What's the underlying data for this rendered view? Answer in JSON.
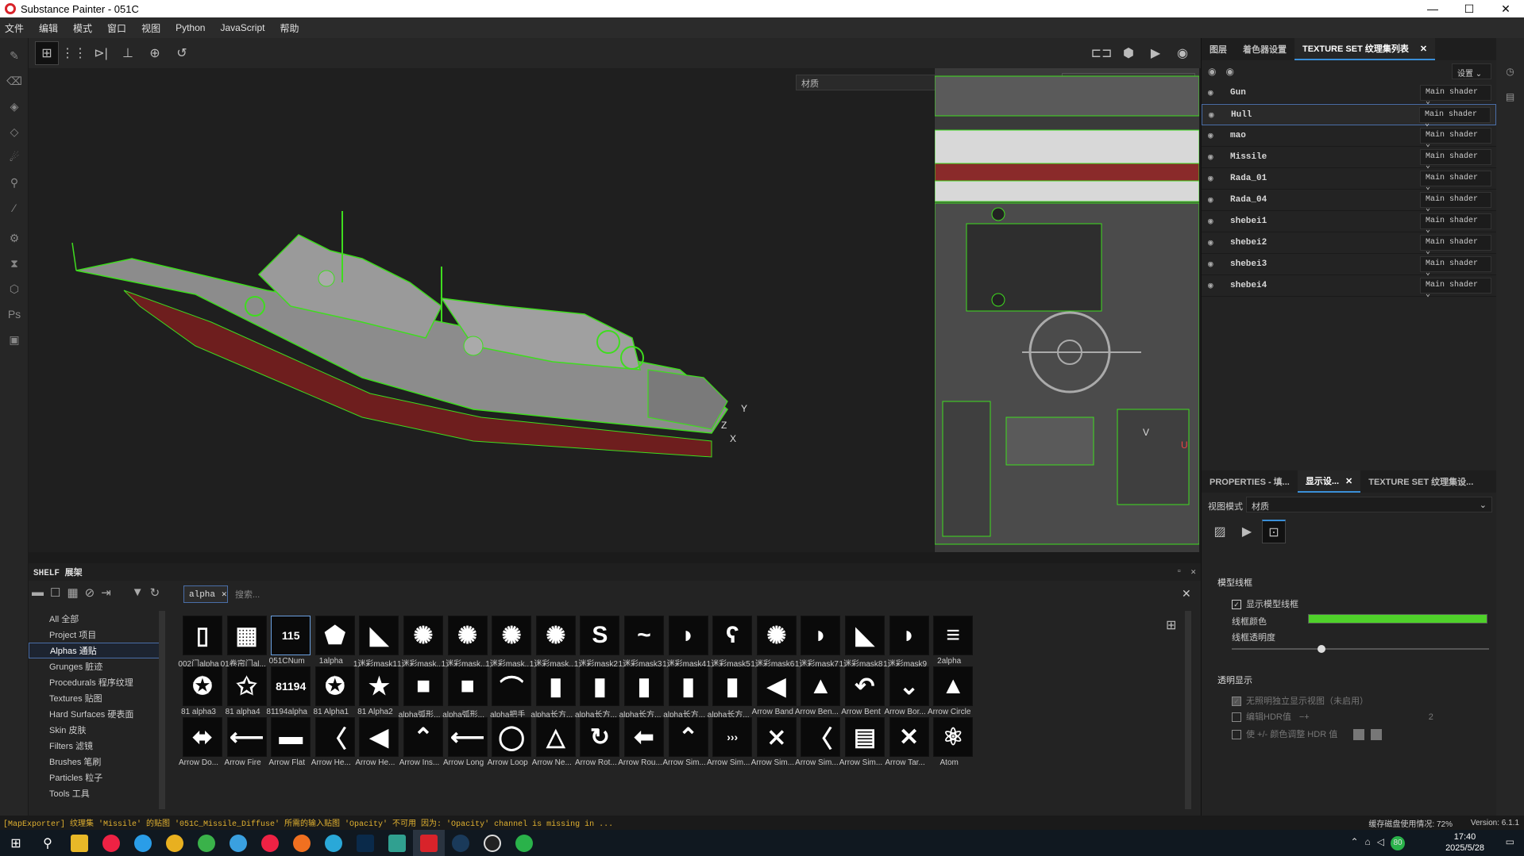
{
  "window": {
    "title": "Substance Painter - 051C"
  },
  "menu": [
    "文件",
    "编辑",
    "模式",
    "窗口",
    "视图",
    "Python",
    "JavaScript",
    "帮助"
  ],
  "viewport": {
    "material_select": "材质",
    "material_select2": "材质",
    "axis_y": "Y",
    "axis_z": "Z",
    "axis_x": "X",
    "uv_v": "V",
    "uv_u": "U"
  },
  "right_tabs": {
    "layers": "图层",
    "shader": "着色器设置",
    "texture_set_list": "TEXTURE SET 纹理集列表"
  },
  "settings_label": "设置",
  "texture_sets": [
    {
      "name": "Gun",
      "shader": "Main shader"
    },
    {
      "name": "Hull",
      "shader": "Main shader"
    },
    {
      "name": "mao",
      "shader": "Main shader"
    },
    {
      "name": "Missile",
      "shader": "Main shader"
    },
    {
      "name": "Rada_01",
      "shader": "Main shader"
    },
    {
      "name": "Rada_04",
      "shader": "Main shader"
    },
    {
      "name": "shebei1",
      "shader": "Main shader"
    },
    {
      "name": "shebei2",
      "shader": "Main shader"
    },
    {
      "name": "shebei3",
      "shader": "Main shader"
    },
    {
      "name": "shebei4",
      "shader": "Main shader"
    }
  ],
  "lower_tabs": {
    "properties": "PROPERTIES - 填...",
    "display": "显示设...",
    "texture_set": "TEXTURE SET 纹理集设..."
  },
  "display": {
    "view_mode_label": "视图模式",
    "view_mode_value": "材质",
    "section_wireframe": "模型线框",
    "show_wireframe": "显示模型线框",
    "wire_color": "线框颜色",
    "wire_opacity": "线框透明度",
    "wire_opacity_value": 0.35,
    "wire_color_hex": "#4fd12a",
    "section_transparency": "透明显示",
    "transparency_opt1": "无照明独立显示视图（未启用）",
    "transparency_opt2": "编辑HDR值",
    "transparency_opt2_value": "2",
    "transparency_opt3": "使 +/- 颜色调整 HDR 值"
  },
  "shelf": {
    "title": "SHELF 展架",
    "filter_chip": "alpha",
    "search_placeholder": "搜索...",
    "categories": [
      "All 全部",
      "Project 项目",
      "Alphas 通贴",
      "Grunges 脏迹",
      "Procedurals 程序纹理",
      "Textures 贴图",
      "Hard Surfaces 硬表面",
      "Skin 皮肤",
      "Filters 滤镜",
      "Brushes 笔刷",
      "Particles 粒子",
      "Tools 工具"
    ],
    "row1": [
      "002门alpha",
      "01卷帘门al...",
      "051CNum",
      "1alpha",
      "1迷彩mask1",
      "1迷彩mask...",
      "1迷彩mask...",
      "1迷彩mask...",
      "1迷彩mask...",
      "1迷彩mask2",
      "1迷彩mask3",
      "1迷彩mask4",
      "1迷彩mask5",
      "1迷彩mask6",
      "1迷彩mask7",
      "1迷彩mask8",
      "1迷彩mask9",
      "2alpha"
    ],
    "row1_glyph": [
      "▯",
      "▦",
      "115",
      "⬟",
      "◣",
      "✺",
      "✺",
      "✺",
      "✺",
      "S",
      "~",
      "◗",
      "ʕ",
      "✺",
      "◗",
      "◣",
      "◗",
      "≡"
    ],
    "row2": [
      "81 alpha3",
      "81 alpha4",
      "81194alpha",
      "81 Alpha1",
      "81 Alpha2",
      "alpha弧形...",
      "alpha弧形...",
      "alpha把手",
      "alpha长方...",
      "alpha长方...",
      "alpha长方...",
      "alpha长方...",
      "alpha长方...",
      "Arrow Band",
      "Arrow Ben...",
      "Arrow Bent",
      "Arrow Bor...",
      "Arrow Circle"
    ],
    "row2_glyph": [
      "✪",
      "✩",
      "81194",
      "✪",
      "★",
      "■",
      "■",
      "⌒",
      "▮",
      "▮",
      "▮",
      "▮",
      "▮",
      "◀",
      "▲",
      "↶",
      "⌄",
      "▲"
    ],
    "row3": [
      "Arrow Do...",
      "Arrow Fire",
      "Arrow Flat",
      "Arrow He...",
      "Arrow He...",
      "Arrow Ins...",
      "Arrow Long",
      "Arrow Loop",
      "Arrow Ne...",
      "Arrow Rot...",
      "Arrow Rou...",
      "Arrow Sim...",
      "Arrow Sim...",
      "Arrow Sim...",
      "Arrow Sim...",
      "Arrow Sim...",
      "Arrow Tar...",
      "Atom"
    ],
    "row3_glyph": [
      "⬌",
      "⟵",
      "▬",
      "〈",
      "◀",
      "⌃",
      "⟵",
      "◯",
      "△",
      "↻",
      "⬅",
      "⌃",
      "›››",
      "⨯",
      "〈",
      "▤",
      "✕",
      "⚛"
    ]
  },
  "status": {
    "message": "[MapExporter] 纹理集 'Missile' 的贴图 '051C_Missile_Diffuse' 所需的输入贴图 'Opacity' 不可用 因为: 'Opacity' channel is missing in ...",
    "disk": "缓存磁盘使用情况: 72%",
    "version": "Version: 6.1.1"
  },
  "taskbar": {
    "time": "17:40",
    "date": "2025/5/28",
    "badge": "80"
  }
}
